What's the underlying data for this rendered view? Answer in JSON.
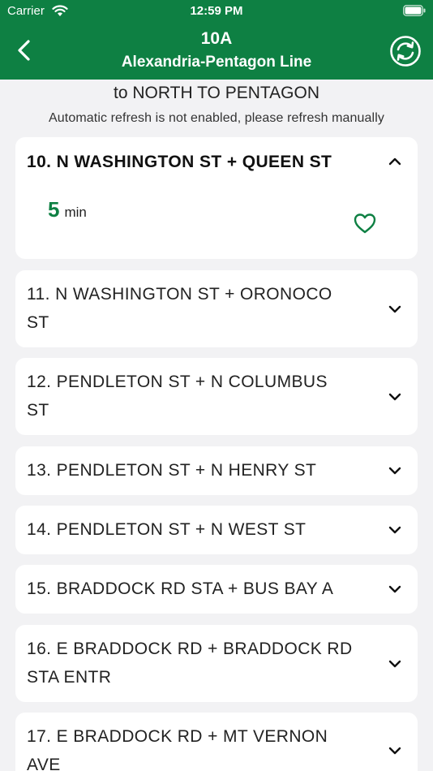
{
  "status_bar": {
    "carrier": "Carrier",
    "time": "12:59 PM"
  },
  "nav": {
    "title": "10A",
    "subtitle": "Alexandria-Pentagon Line"
  },
  "direction": "to NORTH TO PENTAGON",
  "notice": "Automatic refresh is not enabled, please refresh manually",
  "expanded_stop": {
    "name": "10. N WASHINGTON ST + QUEEN ST",
    "eta_value": "5",
    "eta_unit": "min"
  },
  "stops": [
    {
      "line1": "11. N WASHINGTON ST + ORONOCO",
      "line2": "ST"
    },
    {
      "line1": "12. PENDLETON ST + N COLUMBUS",
      "line2": "ST"
    },
    {
      "line1": "13. PENDLETON ST + N HENRY ST",
      "line2": ""
    },
    {
      "line1": "14. PENDLETON ST + N WEST ST",
      "line2": ""
    },
    {
      "line1": "15. BRADDOCK RD STA + BUS BAY A",
      "line2": ""
    },
    {
      "line1": "16. E BRADDOCK RD + BRADDOCK RD",
      "line2": "STA ENTR"
    },
    {
      "line1": "17. E BRADDOCK RD + MT VERNON",
      "line2": "AVE"
    }
  ],
  "colors": {
    "brand_green": "#0e8043",
    "background": "#f2f2f4",
    "card": "#ffffff"
  }
}
